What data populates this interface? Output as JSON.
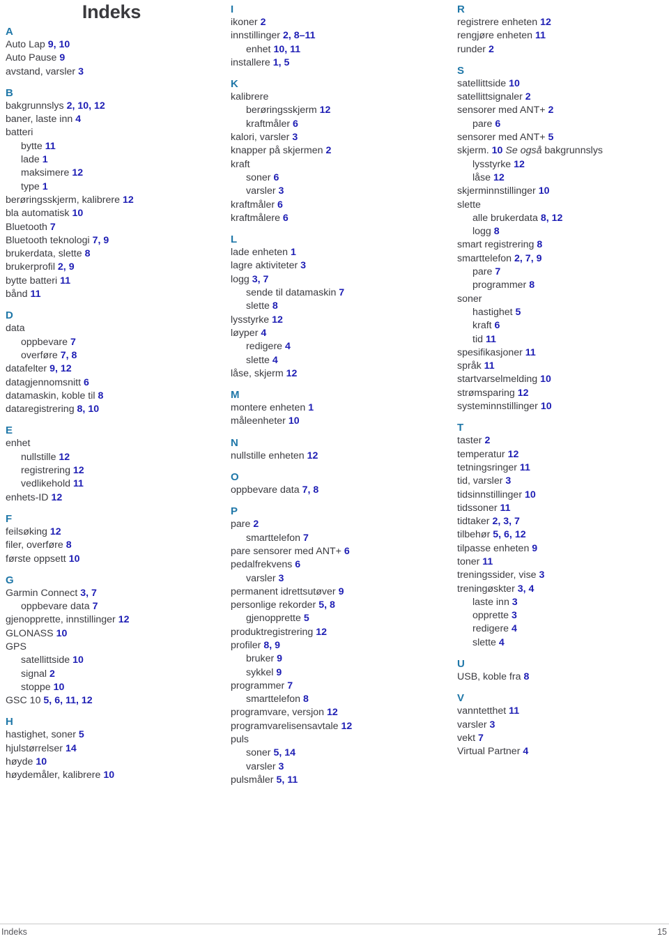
{
  "document": {
    "title": "Indeks",
    "footer_left": "Indeks",
    "footer_page_number": "15",
    "colors": {
      "letter_heading": "#1f77a8",
      "page_number": "#1d1db4",
      "body_text": "#3b3b40",
      "title": "#3a3a3e",
      "rule": "#c9c9c9"
    }
  },
  "columns": [
    {
      "id": "column-1",
      "groups": [
        {
          "letter": "A",
          "entries": [
            {
              "term": "Auto Lap",
              "pages": "9, 10",
              "sub": false
            },
            {
              "term": "Auto Pause",
              "pages": "9",
              "sub": false
            },
            {
              "term": "avstand, varsler",
              "pages": "3",
              "sub": false
            }
          ]
        },
        {
          "letter": "B",
          "entries": [
            {
              "term": "bakgrunnslys",
              "pages": "2, 10, 12",
              "sub": false
            },
            {
              "term": "baner, laste inn",
              "pages": "4",
              "sub": false
            },
            {
              "term": "batteri",
              "pages": "",
              "sub": false
            },
            {
              "term": "bytte",
              "pages": "11",
              "sub": true
            },
            {
              "term": "lade",
              "pages": "1",
              "sub": true
            },
            {
              "term": "maksimere",
              "pages": "12",
              "sub": true
            },
            {
              "term": "type",
              "pages": "1",
              "sub": true
            },
            {
              "term": "berøringsskjerm, kalibrere",
              "pages": "12",
              "sub": false
            },
            {
              "term": "bla automatisk",
              "pages": "10",
              "sub": false
            },
            {
              "term": "Bluetooth",
              "pages": "7",
              "sub": false
            },
            {
              "term": "Bluetooth teknologi",
              "pages": "7, 9",
              "sub": false
            },
            {
              "term": "brukerdata, slette",
              "pages": "8",
              "sub": false
            },
            {
              "term": "brukerprofil",
              "pages": "2, 9",
              "sub": false
            },
            {
              "term": "bytte batteri",
              "pages": "11",
              "sub": false
            },
            {
              "term": "bånd",
              "pages": "11",
              "sub": false
            }
          ]
        },
        {
          "letter": "D",
          "entries": [
            {
              "term": "data",
              "pages": "",
              "sub": false
            },
            {
              "term": "oppbevare",
              "pages": "7",
              "sub": true
            },
            {
              "term": "overføre",
              "pages": "7, 8",
              "sub": true
            },
            {
              "term": "datafelter",
              "pages": "9, 12",
              "sub": false
            },
            {
              "term": "datagjennomsnitt",
              "pages": "6",
              "sub": false
            },
            {
              "term": "datamaskin, koble til",
              "pages": "8",
              "sub": false
            },
            {
              "term": "dataregistrering",
              "pages": "8, 10",
              "sub": false
            }
          ]
        },
        {
          "letter": "E",
          "entries": [
            {
              "term": "enhet",
              "pages": "",
              "sub": false
            },
            {
              "term": "nullstille",
              "pages": "12",
              "sub": true
            },
            {
              "term": "registrering",
              "pages": "12",
              "sub": true
            },
            {
              "term": "vedlikehold",
              "pages": "11",
              "sub": true
            },
            {
              "term": "enhets-ID",
              "pages": "12",
              "sub": false
            }
          ]
        },
        {
          "letter": "F",
          "entries": [
            {
              "term": "feilsøking",
              "pages": "12",
              "sub": false
            },
            {
              "term": "filer, overføre",
              "pages": "8",
              "sub": false
            },
            {
              "term": "første oppsett",
              "pages": "10",
              "sub": false
            }
          ]
        },
        {
          "letter": "G",
          "entries": [
            {
              "term": "Garmin Connect",
              "pages": "3, 7",
              "sub": false
            },
            {
              "term": "oppbevare data",
              "pages": "7",
              "sub": true
            },
            {
              "term": "gjenopprette, innstillinger",
              "pages": "12",
              "sub": false
            },
            {
              "term": "GLONASS",
              "pages": "10",
              "sub": false
            },
            {
              "term": "GPS",
              "pages": "",
              "sub": false
            },
            {
              "term": "satellittside",
              "pages": "10",
              "sub": true
            },
            {
              "term": "signal",
              "pages": "2",
              "sub": true
            },
            {
              "term": "stoppe",
              "pages": "10",
              "sub": true
            },
            {
              "term": "GSC 10",
              "pages": "5, 6, 11, 12",
              "sub": false
            }
          ]
        },
        {
          "letter": "H",
          "entries": [
            {
              "term": "hastighet, soner",
              "pages": "5",
              "sub": false
            },
            {
              "term": "hjulstørrelser",
              "pages": "14",
              "sub": false
            },
            {
              "term": "høyde",
              "pages": "10",
              "sub": false
            },
            {
              "term": "høydemåler, kalibrere",
              "pages": "10",
              "sub": false
            }
          ]
        }
      ]
    },
    {
      "id": "column-2",
      "groups": [
        {
          "letter": "I",
          "entries": [
            {
              "term": "ikoner",
              "pages": "2",
              "sub": false
            },
            {
              "term": "innstillinger",
              "pages": "2, 8–11",
              "sub": false
            },
            {
              "term": "enhet",
              "pages": "10, 11",
              "sub": true
            },
            {
              "term": "installere",
              "pages": "1, 5",
              "sub": false
            }
          ]
        },
        {
          "letter": "K",
          "entries": [
            {
              "term": "kalibrere",
              "pages": "",
              "sub": false
            },
            {
              "term": "berøringsskjerm",
              "pages": "12",
              "sub": true
            },
            {
              "term": "kraftmåler",
              "pages": "6",
              "sub": true
            },
            {
              "term": "kalori, varsler",
              "pages": "3",
              "sub": false
            },
            {
              "term": "knapper på skjermen",
              "pages": "2",
              "sub": false
            },
            {
              "term": "kraft",
              "pages": "",
              "sub": false
            },
            {
              "term": "soner",
              "pages": "6",
              "sub": true
            },
            {
              "term": "varsler",
              "pages": "3",
              "sub": true
            },
            {
              "term": "kraftmåler",
              "pages": "6",
              "sub": false
            },
            {
              "term": "kraftmålere",
              "pages": "6",
              "sub": false
            }
          ]
        },
        {
          "letter": "L",
          "entries": [
            {
              "term": "lade enheten",
              "pages": "1",
              "sub": false
            },
            {
              "term": "lagre aktiviteter",
              "pages": "3",
              "sub": false
            },
            {
              "term": "logg",
              "pages": "3, 7",
              "sub": false
            },
            {
              "term": "sende til datamaskin",
              "pages": "7",
              "sub": true
            },
            {
              "term": "slette",
              "pages": "8",
              "sub": true
            },
            {
              "term": "lysstyrke",
              "pages": "12",
              "sub": false
            },
            {
              "term": "løyper",
              "pages": "4",
              "sub": false
            },
            {
              "term": "redigere",
              "pages": "4",
              "sub": true
            },
            {
              "term": "slette",
              "pages": "4",
              "sub": true
            },
            {
              "term": "låse, skjerm",
              "pages": "12",
              "sub": false
            }
          ]
        },
        {
          "letter": "M",
          "entries": [
            {
              "term": "montere enheten",
              "pages": "1",
              "sub": false
            },
            {
              "term": "måleenheter",
              "pages": "10",
              "sub": false
            }
          ]
        },
        {
          "letter": "N",
          "entries": [
            {
              "term": "nullstille enheten",
              "pages": "12",
              "sub": false
            }
          ]
        },
        {
          "letter": "O",
          "entries": [
            {
              "term": "oppbevare data",
              "pages": "7, 8",
              "sub": false
            }
          ]
        },
        {
          "letter": "P",
          "entries": [
            {
              "term": "pare",
              "pages": "2",
              "sub": false
            },
            {
              "term": "smarttelefon",
              "pages": "7",
              "sub": true
            },
            {
              "term": "pare sensorer med ANT+",
              "pages": "6",
              "sub": false
            },
            {
              "term": "pedalfrekvens",
              "pages": "6",
              "sub": false
            },
            {
              "term": "varsler",
              "pages": "3",
              "sub": true
            },
            {
              "term": "permanent idrettsutøver",
              "pages": "9",
              "sub": false
            },
            {
              "term": "personlige rekorder",
              "pages": "5, 8",
              "sub": false
            },
            {
              "term": "gjenopprette",
              "pages": "5",
              "sub": true
            },
            {
              "term": "produktregistrering",
              "pages": "12",
              "sub": false
            },
            {
              "term": "profiler",
              "pages": "8, 9",
              "sub": false
            },
            {
              "term": "bruker",
              "pages": "9",
              "sub": true
            },
            {
              "term": "sykkel",
              "pages": "9",
              "sub": true
            },
            {
              "term": "programmer",
              "pages": "7",
              "sub": false
            },
            {
              "term": "smarttelefon",
              "pages": "8",
              "sub": true
            },
            {
              "term": "programvare, versjon",
              "pages": "12",
              "sub": false
            },
            {
              "term": "programvarelisensavtale",
              "pages": "12",
              "sub": false
            },
            {
              "term": "puls",
              "pages": "",
              "sub": false
            },
            {
              "term": "soner",
              "pages": "5, 14",
              "sub": true
            },
            {
              "term": "varsler",
              "pages": "3",
              "sub": true
            },
            {
              "term": "pulsmåler",
              "pages": "5, 11",
              "sub": false
            }
          ]
        }
      ]
    },
    {
      "id": "column-3",
      "groups": [
        {
          "letter": "R",
          "entries": [
            {
              "term": "registrere enheten",
              "pages": "12",
              "sub": false
            },
            {
              "term": "rengjøre enheten",
              "pages": "11",
              "sub": false
            },
            {
              "term": "runder",
              "pages": "2",
              "sub": false
            }
          ]
        },
        {
          "letter": "S",
          "entries": [
            {
              "term": "satellittside",
              "pages": "10",
              "sub": false
            },
            {
              "term": "satellittsignaler",
              "pages": "2",
              "sub": false
            },
            {
              "term": "sensorer med ANT+",
              "pages": "2",
              "sub": false
            },
            {
              "term": "pare",
              "pages": "6",
              "sub": true
            },
            {
              "term": "sensorer med ANT+",
              "pages": "5",
              "sub": false
            },
            {
              "term": "skjerm.",
              "pages": "10",
              "sub": false,
              "see_also": "Se også",
              "see_also_target": "bakgrunnslys"
            },
            {
              "term": "lysstyrke",
              "pages": "12",
              "sub": true
            },
            {
              "term": "låse",
              "pages": "12",
              "sub": true
            },
            {
              "term": "skjerminnstillinger",
              "pages": "10",
              "sub": false
            },
            {
              "term": "slette",
              "pages": "",
              "sub": false
            },
            {
              "term": "alle brukerdata",
              "pages": "8, 12",
              "sub": true
            },
            {
              "term": "logg",
              "pages": "8",
              "sub": true
            },
            {
              "term": "smart registrering",
              "pages": "8",
              "sub": false
            },
            {
              "term": "smarttelefon",
              "pages": "2, 7, 9",
              "sub": false
            },
            {
              "term": "pare",
              "pages": "7",
              "sub": true
            },
            {
              "term": "programmer",
              "pages": "8",
              "sub": true
            },
            {
              "term": "soner",
              "pages": "",
              "sub": false
            },
            {
              "term": "hastighet",
              "pages": "5",
              "sub": true
            },
            {
              "term": "kraft",
              "pages": "6",
              "sub": true
            },
            {
              "term": "tid",
              "pages": "11",
              "sub": true
            },
            {
              "term": "spesifikasjoner",
              "pages": "11",
              "sub": false
            },
            {
              "term": "språk",
              "pages": "11",
              "sub": false
            },
            {
              "term": "startvarselmelding",
              "pages": "10",
              "sub": false
            },
            {
              "term": "strømsparing",
              "pages": "12",
              "sub": false
            },
            {
              "term": "systeminnstillinger",
              "pages": "10",
              "sub": false
            }
          ]
        },
        {
          "letter": "T",
          "entries": [
            {
              "term": "taster",
              "pages": "2",
              "sub": false
            },
            {
              "term": "temperatur",
              "pages": "12",
              "sub": false
            },
            {
              "term": "tetningsringer",
              "pages": "11",
              "sub": false
            },
            {
              "term": "tid, varsler",
              "pages": "3",
              "sub": false
            },
            {
              "term": "tidsinnstillinger",
              "pages": "10",
              "sub": false
            },
            {
              "term": "tidssoner",
              "pages": "11",
              "sub": false
            },
            {
              "term": "tidtaker",
              "pages": "2, 3, 7",
              "sub": false
            },
            {
              "term": "tilbehør",
              "pages": "5, 6, 12",
              "sub": false
            },
            {
              "term": "tilpasse enheten",
              "pages": "9",
              "sub": false
            },
            {
              "term": "toner",
              "pages": "11",
              "sub": false
            },
            {
              "term": "treningssider, vise",
              "pages": "3",
              "sub": false
            },
            {
              "term": "treningøskter",
              "pages": "3, 4",
              "sub": false
            },
            {
              "term": "laste inn",
              "pages": "3",
              "sub": true
            },
            {
              "term": "opprette",
              "pages": "3",
              "sub": true
            },
            {
              "term": "redigere",
              "pages": "4",
              "sub": true
            },
            {
              "term": "slette",
              "pages": "4",
              "sub": true
            }
          ]
        },
        {
          "letter": "U",
          "entries": [
            {
              "term": "USB, koble fra",
              "pages": "8",
              "sub": false
            }
          ]
        },
        {
          "letter": "V",
          "entries": [
            {
              "term": "vanntetthet",
              "pages": "11",
              "sub": false
            },
            {
              "term": "varsler",
              "pages": "3",
              "sub": false
            },
            {
              "term": "vekt",
              "pages": "7",
              "sub": false
            },
            {
              "term": "Virtual Partner",
              "pages": "4",
              "sub": false
            }
          ]
        }
      ]
    }
  ]
}
